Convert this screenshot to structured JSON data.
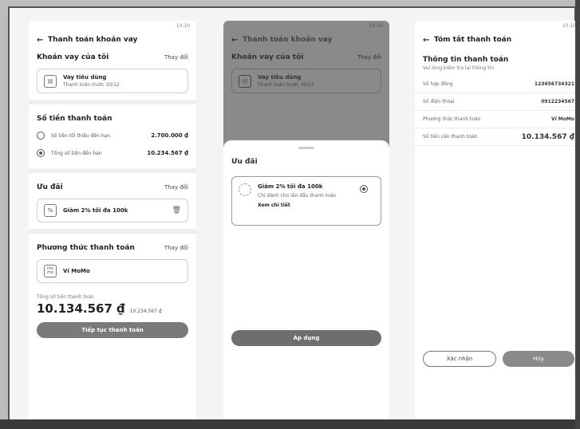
{
  "status_time": "10:10",
  "screen1": {
    "title": "Thanh toán khoản vay",
    "loan_section": {
      "title": "Khoản vay của tôi",
      "action": "Thay đổi"
    },
    "loan_card": {
      "name": "Vay tiêu dùng",
      "sub": "Thanh toán trước 30/12"
    },
    "amount_section": {
      "title": "Số tiền thanh toán"
    },
    "options": [
      {
        "label": "Số tiền tối thiểu đến hạn",
        "amount": "2.700.000 ₫",
        "selected": false
      },
      {
        "label": "Tổng số tiền đến hạn",
        "amount": "10.234.567 ₫",
        "selected": true
      }
    ],
    "offer_section": {
      "title": "Ưu đãi",
      "action": "Thay đổi"
    },
    "offer_card": {
      "text": "Giảm 2% tối đa 100k"
    },
    "method_section": {
      "title": "Phương thức thanh toán",
      "action": "Thay đổi"
    },
    "method_card": {
      "icon_text": "mo mo",
      "name": "Ví MoMo"
    },
    "total_label": "Tổng số tiền thanh toán",
    "total_amount": "10.134.567 ₫",
    "total_old": "10.234.567 ₫",
    "continue_label": "Tiếp tục thanh toán"
  },
  "screen2": {
    "title": "Thanh toán khoản vay",
    "loan_section": {
      "title": "Khoản vay của tôi",
      "action": "Thay đổi"
    },
    "loan_card": {
      "name": "Vay tiêu dùng",
      "sub": "Thanh toán trước 30/12"
    },
    "sheet_title": "Ưu đãi",
    "offer": {
      "title": "Giảm 2% tối đa 100k",
      "desc": "Chỉ dành cho lần đầu thanh toán",
      "link": "Xem chi tiết"
    },
    "apply_label": "Áp dụng"
  },
  "screen3": {
    "title": "Tóm tắt thanh toán",
    "info_title": "Thông tin thanh toán",
    "info_sub": "Vui lòng kiểm tra lại thông tin",
    "rows": [
      {
        "label": "Số hợp đồng",
        "value": "123456734321"
      },
      {
        "label": "Số điện thoại",
        "value": "0912234567"
      },
      {
        "label": "Phương thức thanh toán",
        "value": "Ví MoMo"
      },
      {
        "label": "Số tiền cần thanh toán",
        "value": "10.134.567 ₫"
      }
    ],
    "confirm_label": "Xác nhận",
    "cancel_label": "Hủy"
  }
}
